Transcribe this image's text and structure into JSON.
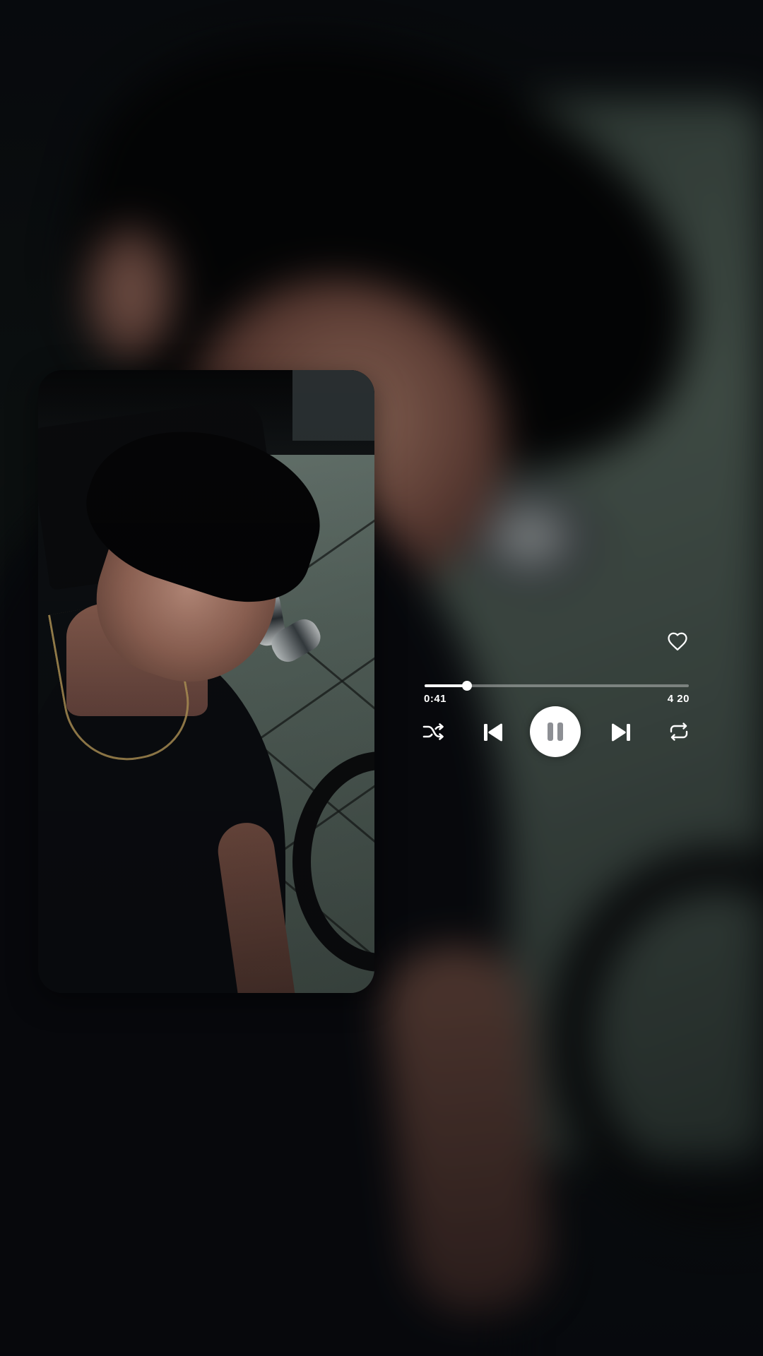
{
  "player": {
    "elapsed": "0:41",
    "total": "4 20",
    "progress": 0.16,
    "is_playing": true,
    "liked": false
  },
  "controls": {
    "shuffle_icon": "shuffle-icon",
    "previous_icon": "skip-previous-icon",
    "play_pause_icon": "pause-icon",
    "next_icon": "skip-next-icon",
    "repeat_icon": "repeat-icon",
    "like_icon": "heart-outline-icon"
  },
  "colors": {
    "accent": "#ffffff",
    "pause_glyph": "#8d8f94",
    "track": "rgba(255,255,255,0.35)"
  }
}
